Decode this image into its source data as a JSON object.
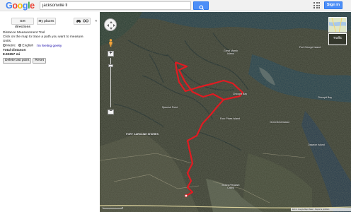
{
  "header": {
    "logo": "Google",
    "search_value": "jacksonville fl",
    "signin_label": "Sign in"
  },
  "sidebar": {
    "get_directions_label": "Get directions",
    "my_places_label": "My places",
    "collapse_glyph": "«"
  },
  "distance_tool": {
    "title": "Distance Measurement Tool",
    "instructions": "Click on the map to trace a path you want to measure.",
    "units_label": "Units:",
    "metric_label": "Metric",
    "english_label": "English",
    "feeling_geeky": "I'm feeling geeky",
    "total_label": "Total distance:",
    "total_value": "8.92657 mi",
    "delete_button": "Delete last point",
    "reset_button": "Reset"
  },
  "map": {
    "traffic_label": "Traffic",
    "place_labels": {
      "clear_marsh": "Great Marsh Island",
      "chicopit_bay": "Chicopit Bay",
      "chicopit_bay_east": "Chicopit Bay",
      "spanish_point": "Spanish Point",
      "fort_caroline_shores": "FORT CAROLINE SHORES",
      "four_pines": "Four Pines Island",
      "greenfield": "Greenfield Island",
      "dawson_island": "Dawson Island",
      "mt_pleasant": "Mount Pleasant Creek",
      "fort_george_north": "Fort George Island"
    },
    "footer_text": "Edit in Google Map Maker · Report a problem",
    "path_color": "#e11b22",
    "water_color": "#1f3a45",
    "land_color": "#3a3d30"
  }
}
